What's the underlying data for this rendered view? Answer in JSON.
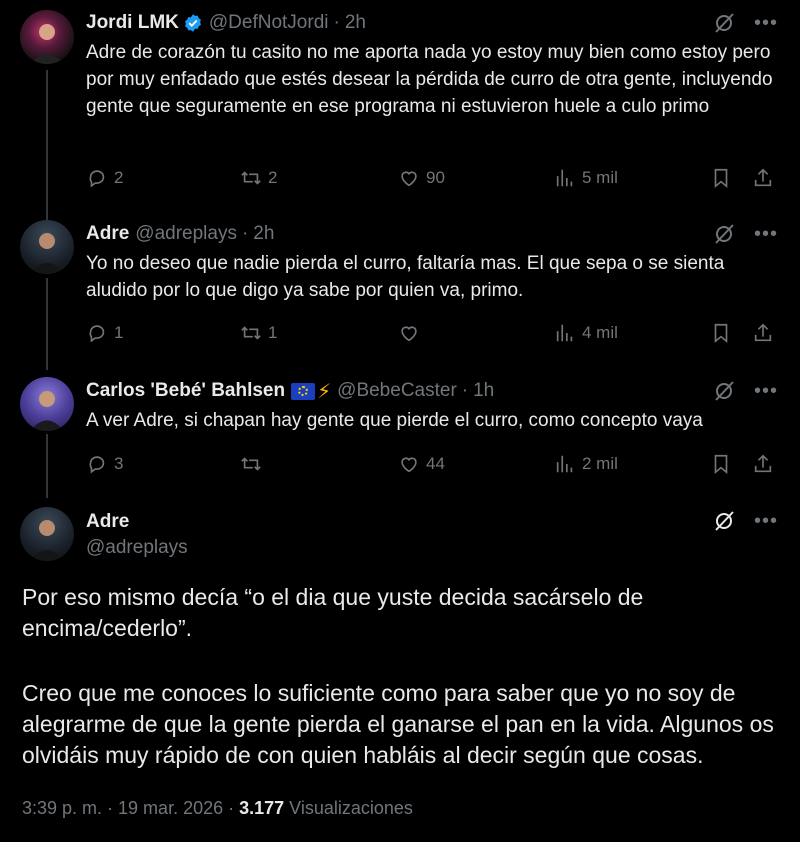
{
  "tweets": [
    {
      "name": "Jordi LMK",
      "handle": "@DefNotJordi",
      "time": "2h",
      "text": "Adre de corazón tu casito no me aporta nada yo estoy muy bien como estoy pero por muy enfadado que estés desear la pérdida de curro de otra gente, incluyendo gente que seguramente en ese programa ni estuvieron huele a culo primo",
      "replies": "2",
      "retweets": "2",
      "likes": "90",
      "views": "5 mil"
    },
    {
      "name": "Adre",
      "handle": "@adreplays",
      "time": "2h",
      "text": "Yo no deseo que nadie pierda el curro, faltaría mas. El que sepa o se sienta aludido por lo que digo ya sabe por quien va, primo.",
      "replies": "1",
      "retweets": "1",
      "likes": "",
      "views": "4 mil"
    },
    {
      "name": "Carlos 'Bebé' Bahlsen",
      "handle": "@BebeCaster",
      "time": "1h",
      "text": "A ver Adre, si chapan hay gente que pierde el curro, como concepto vaya",
      "replies": "3",
      "retweets": "",
      "likes": "44",
      "views": "2 mil"
    }
  ],
  "main": {
    "name": "Adre",
    "handle": "@adreplays",
    "paragraph1": "Por eso mismo decía “o el dia que yuste decida sacárselo de encima/cederlo”.",
    "paragraph2": "Creo que me conoces lo suficiente como para saber que yo no soy de alegrarme de que la gente pierda el ganarse el pan en la vida. Algunos os olvidáis muy rápido de con quien habláis al decir según que cosas.",
    "timestamp": "3:39 p. m. · 19 mar. 2026 · ",
    "views_count": "3.177",
    "views_label": "Visualizaciones"
  },
  "colors": {
    "background": "#000000",
    "text": "#e7e9ea",
    "secondary": "#71767b",
    "verified": "#1d9bf0"
  }
}
